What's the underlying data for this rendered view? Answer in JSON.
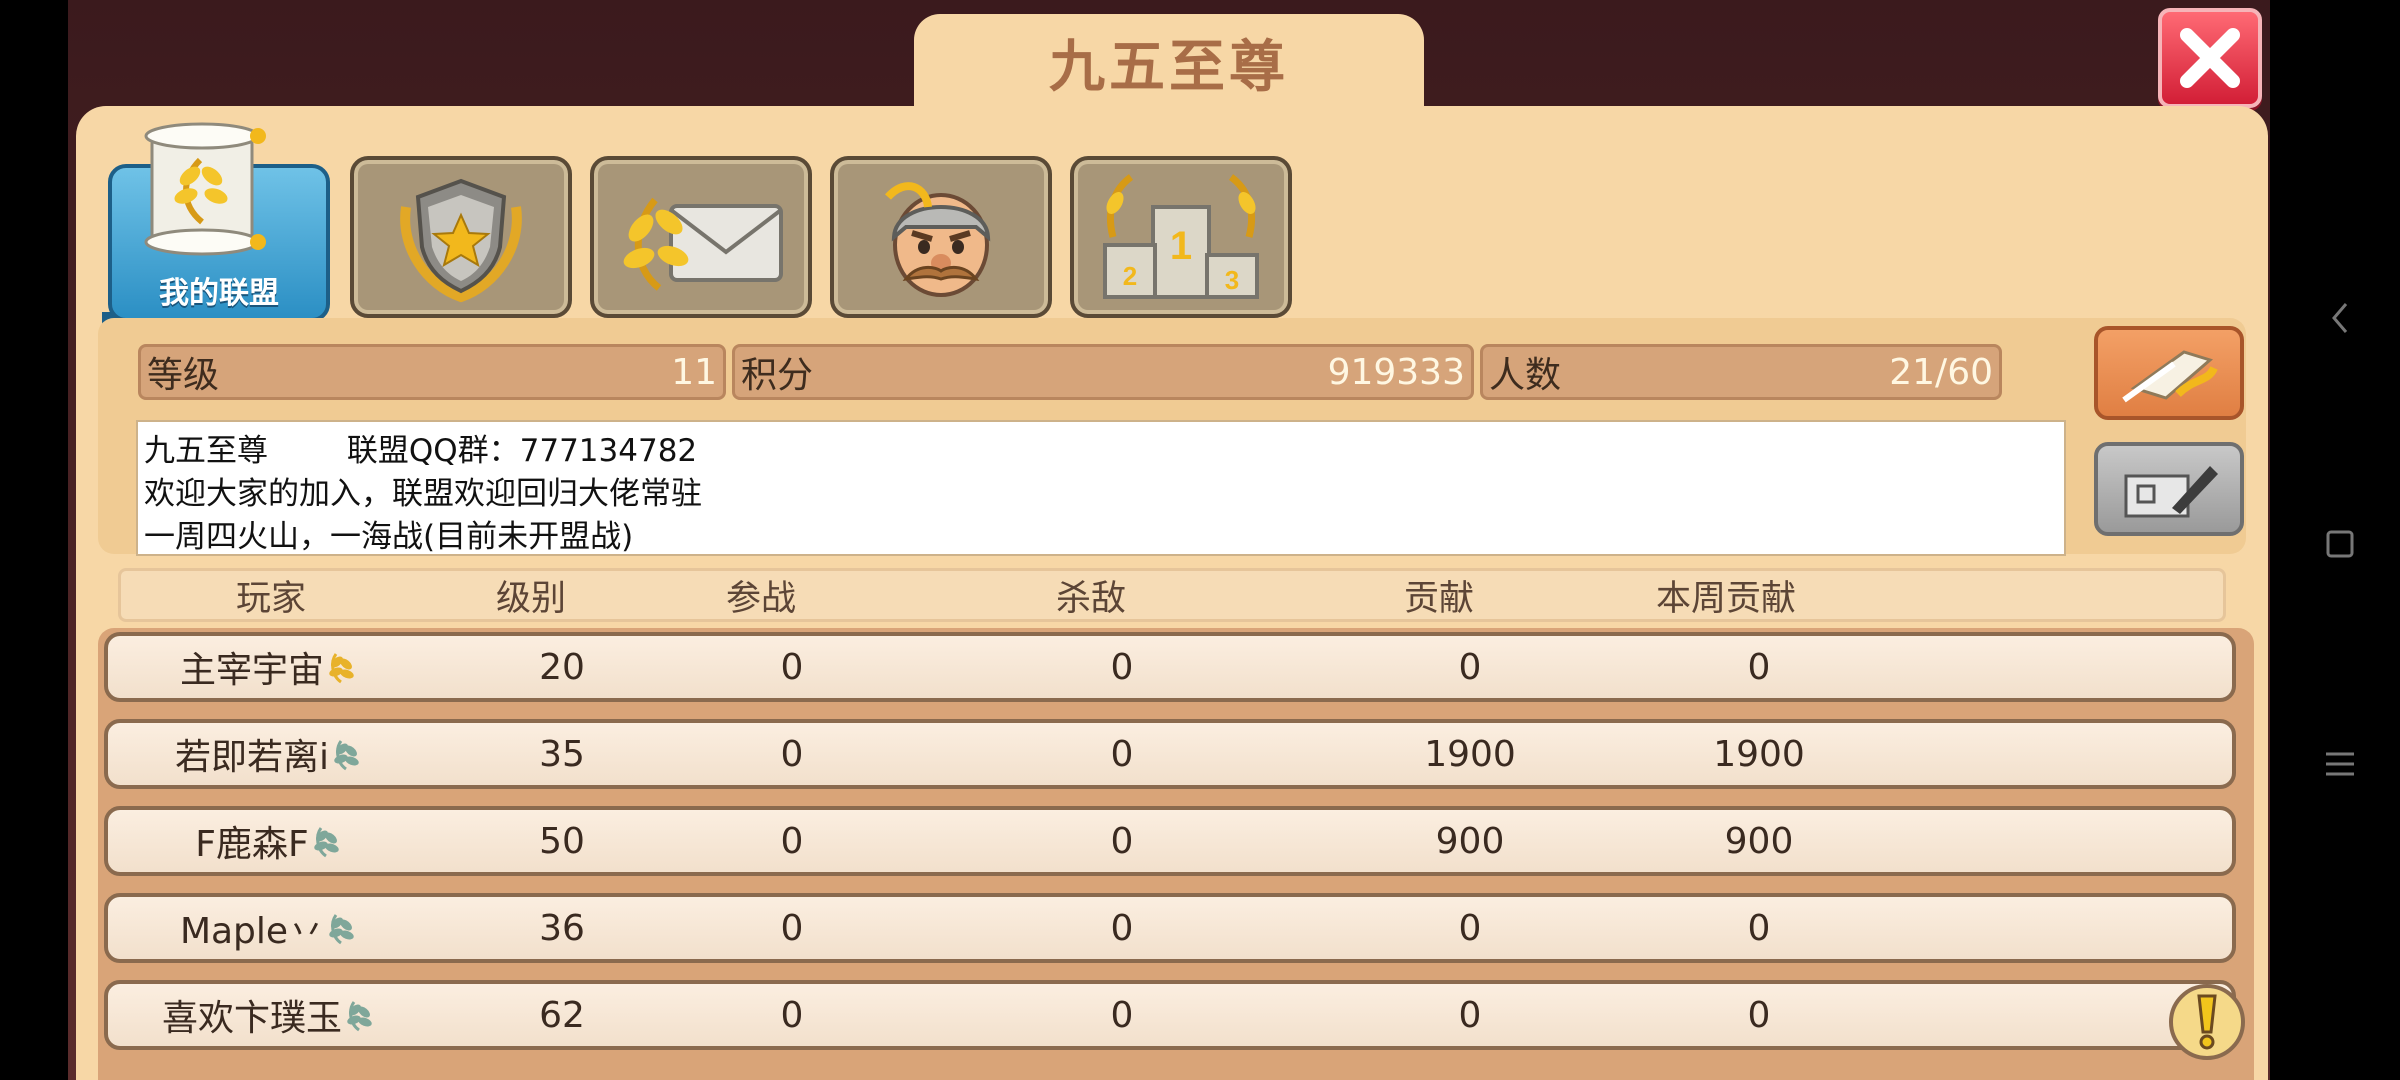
{
  "header": {
    "title": "九五至尊"
  },
  "tabs": [
    {
      "label": "我的联盟",
      "icon": "scroll-laurel-icon",
      "active": true
    },
    {
      "icon": "shield-star-icon"
    },
    {
      "icon": "laurel-mail-icon"
    },
    {
      "icon": "viking-warrior-icon"
    },
    {
      "icon": "podium-ranking-icon"
    }
  ],
  "stats": {
    "level_label": "等级",
    "level_value": "11",
    "score_label": "积分",
    "score_value": "919333",
    "members_label": "人数",
    "members_value": "21/60"
  },
  "notice": {
    "line1": "九五至尊        联盟QQ群：777134782",
    "line2": "欢迎大家的加入，联盟欢迎回归大佬常驻",
    "line3": "一周四火山，一海战(目前未开盟战)"
  },
  "table": {
    "headers": [
      "玩家",
      "级别",
      "参战",
      "杀敌",
      "贡献",
      "本周贡献"
    ],
    "rows": [
      {
        "player": "主宰宇宙",
        "badge": "gold",
        "level": "20",
        "battles": "0",
        "kills": "0",
        "contribution": "0",
        "weekly": "0"
      },
      {
        "player": "若即若离i",
        "badge": "teal",
        "level": "35",
        "battles": "0",
        "kills": "0",
        "contribution": "1900",
        "weekly": "1900"
      },
      {
        "player": "F鹿森F",
        "badge": "teal",
        "level": "50",
        "battles": "0",
        "kills": "0",
        "contribution": "900",
        "weekly": "900"
      },
      {
        "player": "Maple丷",
        "badge": "teal",
        "level": "36",
        "battles": "0",
        "kills": "0",
        "contribution": "0",
        "weekly": "0"
      },
      {
        "player": "喜欢卞璞玉",
        "badge": "teal",
        "level": "62",
        "battles": "0",
        "kills": "0",
        "contribution": "0",
        "weekly": "0"
      }
    ]
  },
  "colors": {
    "accent_orange": "#ee9355",
    "close_red": "#e3283f",
    "tab_active_blue": "#3a9fd3"
  },
  "icons": {
    "close": "close-icon",
    "edit_notice": "quill-scroll-icon",
    "mail": "write-mail-icon",
    "alert": "exclamation-icon",
    "nav_back": "back-chevron-icon",
    "nav_home": "home-square-icon",
    "nav_menu": "menu-lines-icon"
  }
}
